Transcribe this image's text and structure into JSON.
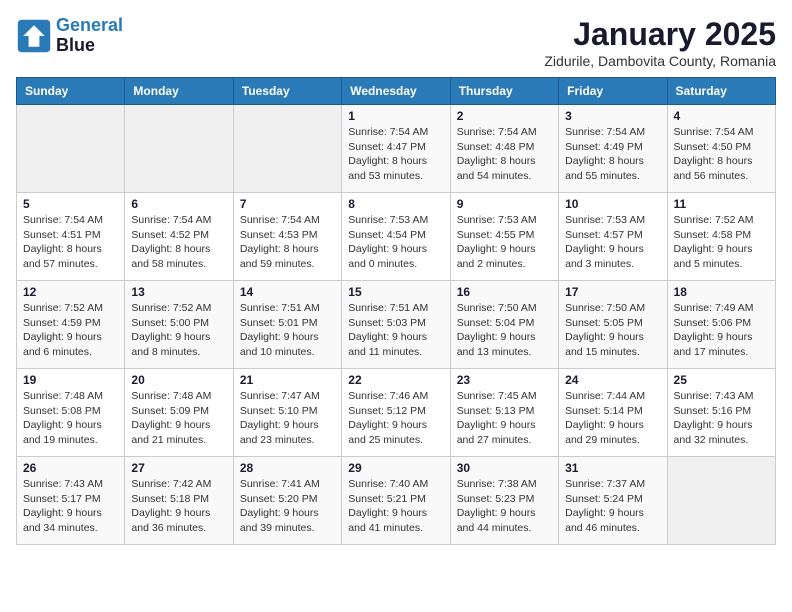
{
  "logo": {
    "line1": "General",
    "line2": "Blue"
  },
  "title": "January 2025",
  "subtitle": "Zidurile, Dambovita County, Romania",
  "days_of_week": [
    "Sunday",
    "Monday",
    "Tuesday",
    "Wednesday",
    "Thursday",
    "Friday",
    "Saturday"
  ],
  "weeks": [
    [
      {
        "day": "",
        "info": ""
      },
      {
        "day": "",
        "info": ""
      },
      {
        "day": "",
        "info": ""
      },
      {
        "day": "1",
        "info": "Sunrise: 7:54 AM\nSunset: 4:47 PM\nDaylight: 8 hours\nand 53 minutes."
      },
      {
        "day": "2",
        "info": "Sunrise: 7:54 AM\nSunset: 4:48 PM\nDaylight: 8 hours\nand 54 minutes."
      },
      {
        "day": "3",
        "info": "Sunrise: 7:54 AM\nSunset: 4:49 PM\nDaylight: 8 hours\nand 55 minutes."
      },
      {
        "day": "4",
        "info": "Sunrise: 7:54 AM\nSunset: 4:50 PM\nDaylight: 8 hours\nand 56 minutes."
      }
    ],
    [
      {
        "day": "5",
        "info": "Sunrise: 7:54 AM\nSunset: 4:51 PM\nDaylight: 8 hours\nand 57 minutes."
      },
      {
        "day": "6",
        "info": "Sunrise: 7:54 AM\nSunset: 4:52 PM\nDaylight: 8 hours\nand 58 minutes."
      },
      {
        "day": "7",
        "info": "Sunrise: 7:54 AM\nSunset: 4:53 PM\nDaylight: 8 hours\nand 59 minutes."
      },
      {
        "day": "8",
        "info": "Sunrise: 7:53 AM\nSunset: 4:54 PM\nDaylight: 9 hours\nand 0 minutes."
      },
      {
        "day": "9",
        "info": "Sunrise: 7:53 AM\nSunset: 4:55 PM\nDaylight: 9 hours\nand 2 minutes."
      },
      {
        "day": "10",
        "info": "Sunrise: 7:53 AM\nSunset: 4:57 PM\nDaylight: 9 hours\nand 3 minutes."
      },
      {
        "day": "11",
        "info": "Sunrise: 7:52 AM\nSunset: 4:58 PM\nDaylight: 9 hours\nand 5 minutes."
      }
    ],
    [
      {
        "day": "12",
        "info": "Sunrise: 7:52 AM\nSunset: 4:59 PM\nDaylight: 9 hours\nand 6 minutes."
      },
      {
        "day": "13",
        "info": "Sunrise: 7:52 AM\nSunset: 5:00 PM\nDaylight: 9 hours\nand 8 minutes."
      },
      {
        "day": "14",
        "info": "Sunrise: 7:51 AM\nSunset: 5:01 PM\nDaylight: 9 hours\nand 10 minutes."
      },
      {
        "day": "15",
        "info": "Sunrise: 7:51 AM\nSunset: 5:03 PM\nDaylight: 9 hours\nand 11 minutes."
      },
      {
        "day": "16",
        "info": "Sunrise: 7:50 AM\nSunset: 5:04 PM\nDaylight: 9 hours\nand 13 minutes."
      },
      {
        "day": "17",
        "info": "Sunrise: 7:50 AM\nSunset: 5:05 PM\nDaylight: 9 hours\nand 15 minutes."
      },
      {
        "day": "18",
        "info": "Sunrise: 7:49 AM\nSunset: 5:06 PM\nDaylight: 9 hours\nand 17 minutes."
      }
    ],
    [
      {
        "day": "19",
        "info": "Sunrise: 7:48 AM\nSunset: 5:08 PM\nDaylight: 9 hours\nand 19 minutes."
      },
      {
        "day": "20",
        "info": "Sunrise: 7:48 AM\nSunset: 5:09 PM\nDaylight: 9 hours\nand 21 minutes."
      },
      {
        "day": "21",
        "info": "Sunrise: 7:47 AM\nSunset: 5:10 PM\nDaylight: 9 hours\nand 23 minutes."
      },
      {
        "day": "22",
        "info": "Sunrise: 7:46 AM\nSunset: 5:12 PM\nDaylight: 9 hours\nand 25 minutes."
      },
      {
        "day": "23",
        "info": "Sunrise: 7:45 AM\nSunset: 5:13 PM\nDaylight: 9 hours\nand 27 minutes."
      },
      {
        "day": "24",
        "info": "Sunrise: 7:44 AM\nSunset: 5:14 PM\nDaylight: 9 hours\nand 29 minutes."
      },
      {
        "day": "25",
        "info": "Sunrise: 7:43 AM\nSunset: 5:16 PM\nDaylight: 9 hours\nand 32 minutes."
      }
    ],
    [
      {
        "day": "26",
        "info": "Sunrise: 7:43 AM\nSunset: 5:17 PM\nDaylight: 9 hours\nand 34 minutes."
      },
      {
        "day": "27",
        "info": "Sunrise: 7:42 AM\nSunset: 5:18 PM\nDaylight: 9 hours\nand 36 minutes."
      },
      {
        "day": "28",
        "info": "Sunrise: 7:41 AM\nSunset: 5:20 PM\nDaylight: 9 hours\nand 39 minutes."
      },
      {
        "day": "29",
        "info": "Sunrise: 7:40 AM\nSunset: 5:21 PM\nDaylight: 9 hours\nand 41 minutes."
      },
      {
        "day": "30",
        "info": "Sunrise: 7:38 AM\nSunset: 5:23 PM\nDaylight: 9 hours\nand 44 minutes."
      },
      {
        "day": "31",
        "info": "Sunrise: 7:37 AM\nSunset: 5:24 PM\nDaylight: 9 hours\nand 46 minutes."
      },
      {
        "day": "",
        "info": ""
      }
    ]
  ]
}
